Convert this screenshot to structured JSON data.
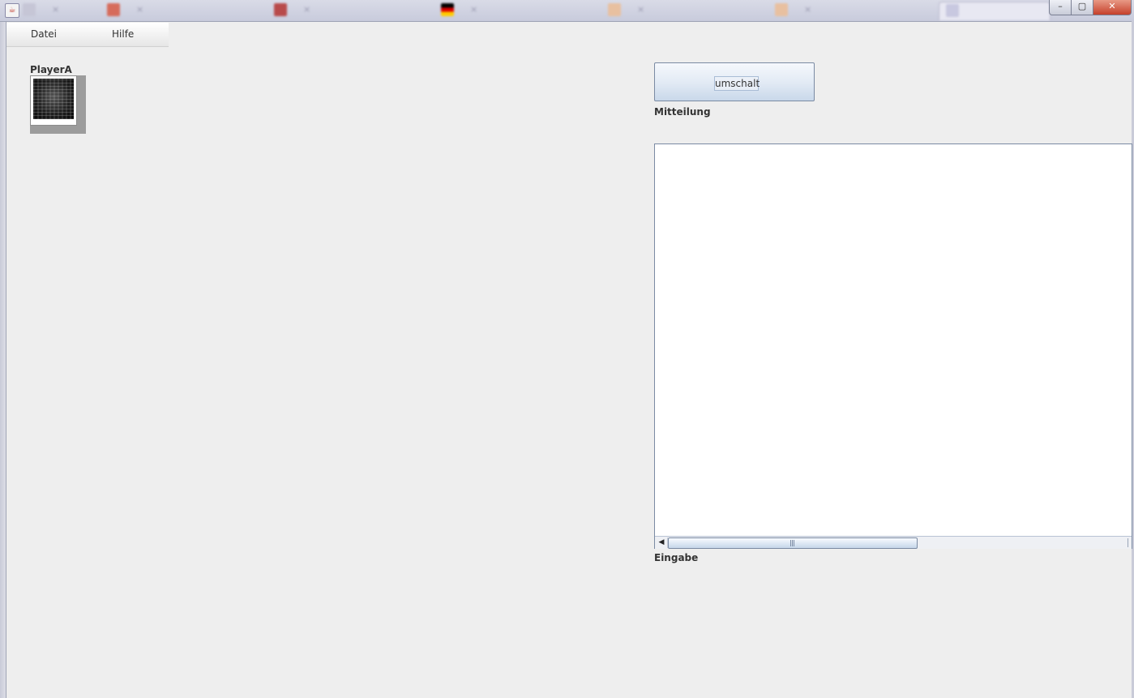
{
  "menu": {
    "items": [
      {
        "label": "Datei"
      },
      {
        "label": "Hilfe"
      }
    ]
  },
  "player": {
    "label": "PlayerA"
  },
  "toggle_button": {
    "label": "umschalt"
  },
  "labels": {
    "message": "Mitteilung",
    "input": "Eingabe"
  },
  "window": {
    "controls": {
      "minimize": "–",
      "maximize": "▢",
      "close": "✕"
    }
  },
  "colors": {
    "background": "#eeeeee",
    "button_gradient_top": "#f5f8fc",
    "button_gradient_bottom": "#c9d8ea",
    "border_blue": "#7a8aa3"
  }
}
